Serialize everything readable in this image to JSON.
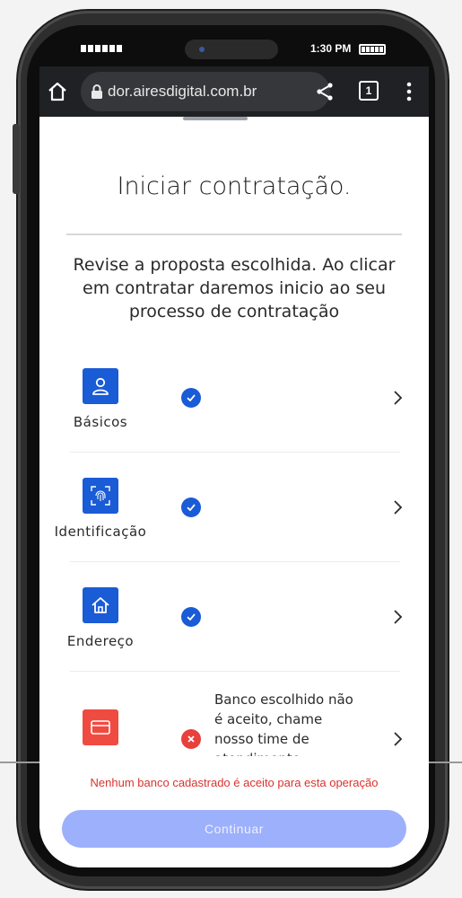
{
  "status_bar": {
    "time": "1:30 PM"
  },
  "browser": {
    "url": "dor.airesdigital.com.br",
    "tab_count": "1"
  },
  "page": {
    "title": "Iniciar contratação.",
    "intro": "Revise a proposta escolhida. Ao clicar em contratar daremos inicio ao seu processo de contratação"
  },
  "steps": [
    {
      "label": "Básicos",
      "icon": "user-icon",
      "status": "ok"
    },
    {
      "label": "Identificação",
      "icon": "fingerprint-icon",
      "status": "ok"
    },
    {
      "label": "Endereço",
      "icon": "home-icon",
      "status": "ok"
    },
    {
      "label": "",
      "icon": "credit-card-icon",
      "status": "error",
      "message": "Banco escolhido não é aceito, chame nosso time de atendimento"
    }
  ],
  "error_message": "Nenhum banco cadastrado é aceito para esta operação",
  "continue_label": "Continuar",
  "colors": {
    "primary": "#1a5bd6",
    "error": "#e8403a",
    "button_disabled": "#9db0fb"
  }
}
